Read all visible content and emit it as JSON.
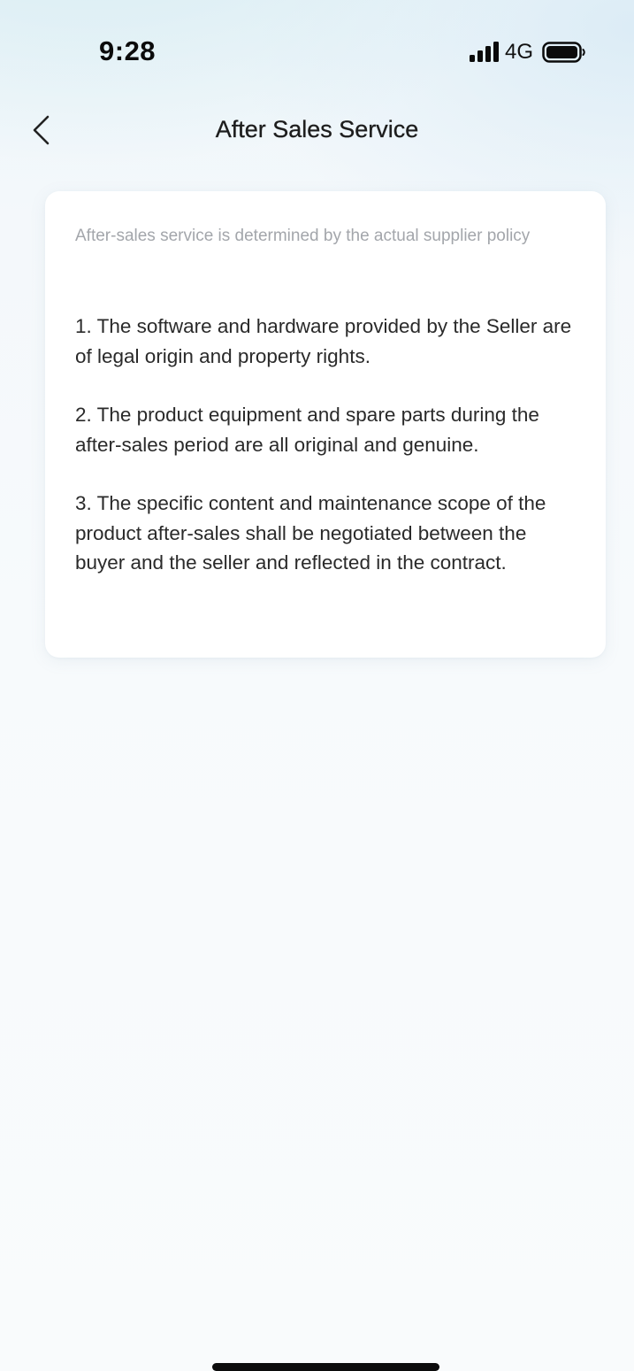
{
  "status_bar": {
    "time": "9:28",
    "network": "4G",
    "icons": [
      "signal-icon",
      "battery-icon"
    ]
  },
  "nav": {
    "back_icon": "chevron-left-icon",
    "title": "After Sales Service"
  },
  "card": {
    "note": "After-sales service is determined by the actual supplier policy",
    "terms": [
      "1. The software and hardware provided by the Seller are of legal origin and property rights.",
      "2. The product equipment and spare parts during the after-sales period are all original and genuine.",
      "3. The specific content and maintenance scope of the product after-sales shall be negotiated between the buyer and the seller and reflected in the contract."
    ]
  },
  "colors": {
    "note_text": "#a3a6ab",
    "body_text": "#2a2a2a",
    "title_text": "#1d1d1d",
    "card_background": "#ffffff",
    "page_gradient_top": "#d6ecf2"
  }
}
